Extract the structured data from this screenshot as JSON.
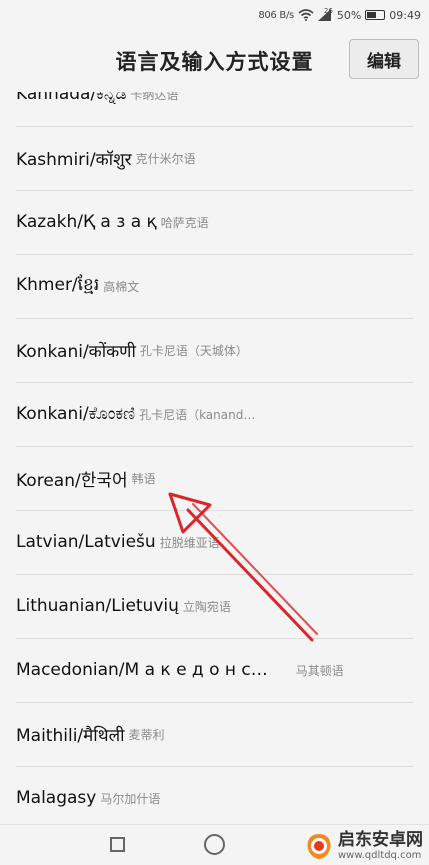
{
  "status_bar": {
    "speed": "806 B/s",
    "network": "26",
    "battery": "50%",
    "time": "09:49"
  },
  "header": {
    "title": "语言及输入方式设置",
    "edit_label": "编辑"
  },
  "languages": [
    {
      "name": "Kannada/ಕನ್ನಡ",
      "sub": "卡纳达语"
    },
    {
      "name": "Kashmiri/कॉशुर",
      "sub": "克什米尔语"
    },
    {
      "name": "Kazakh/Қ а з а қ",
      "sub": "哈萨克语"
    },
    {
      "name": "Khmer/ខ្មែរ",
      "sub": "高棉文"
    },
    {
      "name": "Konkani/कोंकणी",
      "sub": "孔卡尼语（天城体）"
    },
    {
      "name": "Konkani/ಕೊಂಕಣಿ",
      "sub": "孔卡尼语（kanand…"
    },
    {
      "name": "Korean/한국어",
      "sub": "韩语"
    },
    {
      "name": "Latvian/Latviešu",
      "sub": "拉脱维亚语"
    },
    {
      "name": "Lithuanian/Lietuvių",
      "sub": "立陶宛语"
    },
    {
      "name": "Macedonian/М а к е д о н с…",
      "sub": "马其顿语"
    },
    {
      "name": "Maithili/मैथिली",
      "sub": "麦蒂利"
    },
    {
      "name": "Malagasy",
      "sub": "马尔加什语"
    }
  ],
  "watermark": {
    "name": "启东安卓网",
    "url": "www.qdltdq.com"
  },
  "colors": {
    "arrow": "#d9262b",
    "background": "#f4f4f4"
  }
}
